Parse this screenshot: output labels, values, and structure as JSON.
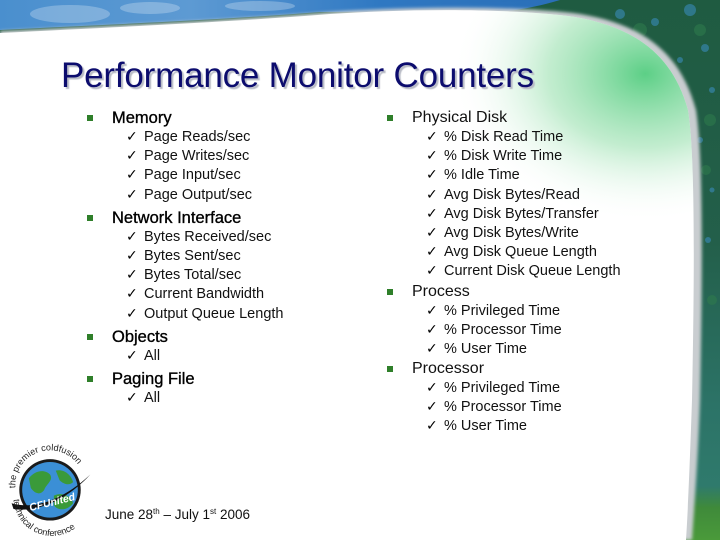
{
  "slide": {
    "title": "Performance Monitor Counters",
    "colors": {
      "title": "#0c0c6e",
      "bullet": "#2f7f2a",
      "sky": "#3f86c8",
      "foliage": "#1d5a3c",
      "accent_green": "#6fd08c"
    },
    "left_column": [
      {
        "category": "Memory",
        "items": [
          "Page Reads/sec",
          "Page Writes/sec",
          "Page Input/sec",
          "Page Output/sec"
        ]
      },
      {
        "category": "Network Interface",
        "items": [
          "Bytes Received/sec",
          "Bytes Sent/sec",
          "Bytes Total/sec",
          "Current Bandwidth",
          "Output Queue Length"
        ]
      },
      {
        "category": "Objects",
        "items": [
          "All"
        ]
      },
      {
        "category": "Paging File",
        "items": [
          "All"
        ]
      }
    ],
    "right_column": [
      {
        "category": "Physical Disk",
        "items": [
          "% Disk Read Time",
          "% Disk Write Time",
          "% Idle Time",
          "Avg Disk Bytes/Read",
          "Avg Disk Bytes/Transfer",
          "Avg Disk Bytes/Write",
          "Avg Disk Queue Length",
          "Current Disk Queue Length"
        ]
      },
      {
        "category": "Process",
        "items": [
          "% Privileged Time",
          "% Processor Time",
          "% User Time"
        ]
      },
      {
        "category": "Processor",
        "items": [
          "% Privileged Time",
          "% Processor Time",
          "% User Time"
        ]
      }
    ],
    "bullet_icon": "square-bullet-icon",
    "check_icon": "checkmark-icon",
    "check_glyph": "✓",
    "footer": {
      "date_parts": {
        "start_month_day": "June 28",
        "start_suffix": "th",
        "separator": " – ",
        "end_month_day": "July 1",
        "end_suffix": "st",
        "year": " 2006"
      }
    },
    "logo": {
      "top_arc_text": "the premier coldfusion",
      "bottom_arc_text": "technical conference",
      "brand": "CFUnited"
    }
  }
}
